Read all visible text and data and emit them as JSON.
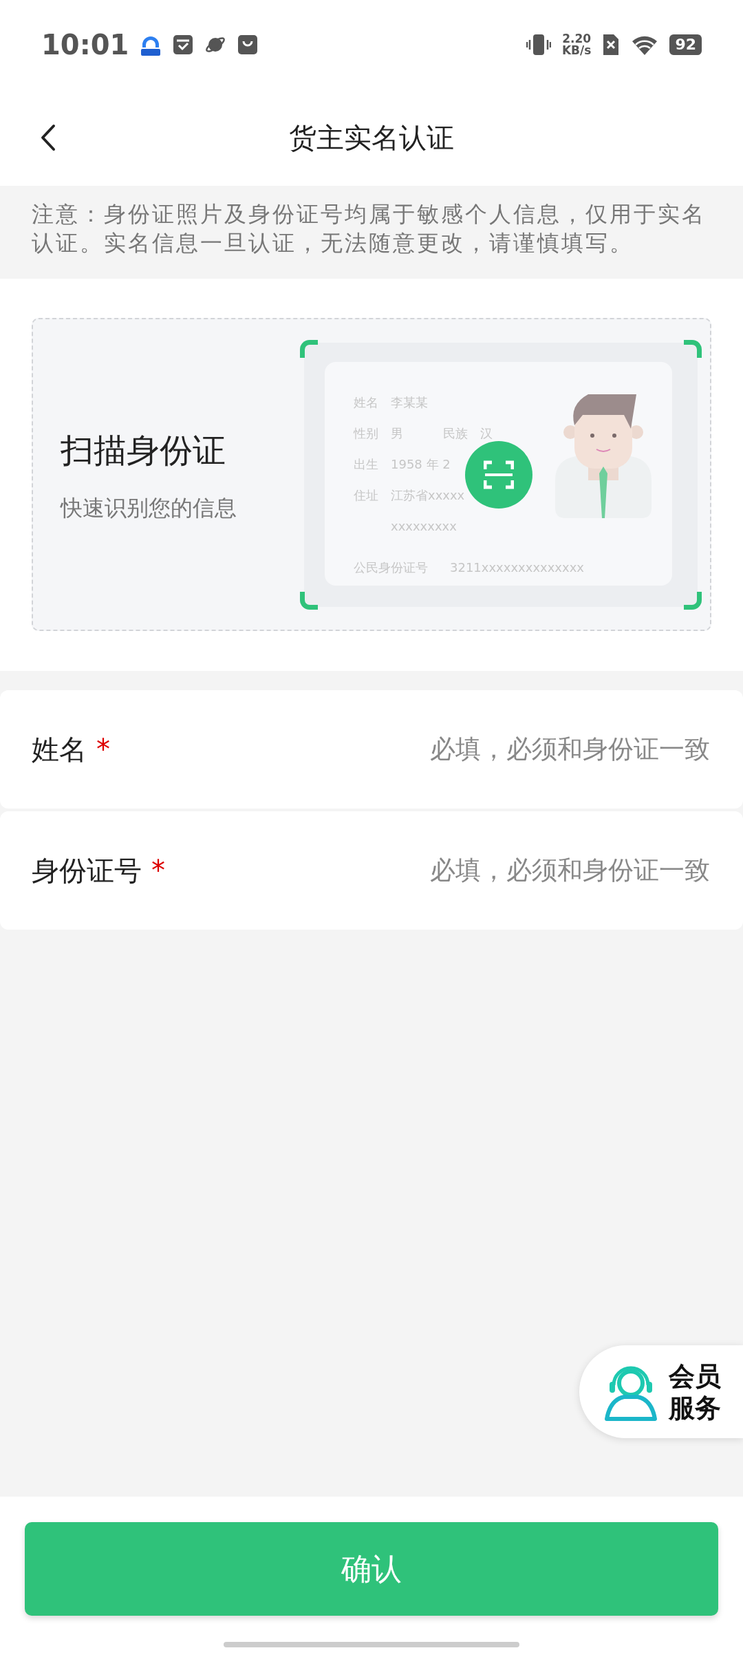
{
  "status_bar": {
    "time": "10:01",
    "net_speed": [
      "2.20",
      "KB/s"
    ],
    "battery": "92"
  },
  "header": {
    "title": "货主实名认证"
  },
  "notice": "注意：身份证照片及身份证号均属于敏感个人信息，仅用于实名认证。实名信息一旦认证，无法随意更改，请谨慎填写。",
  "scan_card": {
    "title": "扫描身份证",
    "subtitle": "快速识别您的信息",
    "id_sample": {
      "rows": [
        {
          "label": "姓名",
          "value": "李某某"
        },
        {
          "label": "性别",
          "value": "男",
          "label2": "民族",
          "value2": "汉"
        },
        {
          "label": "出生",
          "value": "1958 年 2"
        },
        {
          "label": "住址",
          "value": "江苏省xxxxx",
          "value_line2": "xxxxxxxxx"
        }
      ],
      "id_label": "公民身份证号",
      "id_value": "3211xxxxxxxxxxxxxx"
    }
  },
  "form_fields": [
    {
      "label": "姓名",
      "required_mark": "*",
      "placeholder": "必填，必须和身份证一致"
    },
    {
      "label": "身份证号",
      "required_mark": "*",
      "placeholder": "必填，必须和身份证一致"
    }
  ],
  "member_service": {
    "lines": [
      "会员",
      "服务"
    ]
  },
  "confirm_button": "确认"
}
